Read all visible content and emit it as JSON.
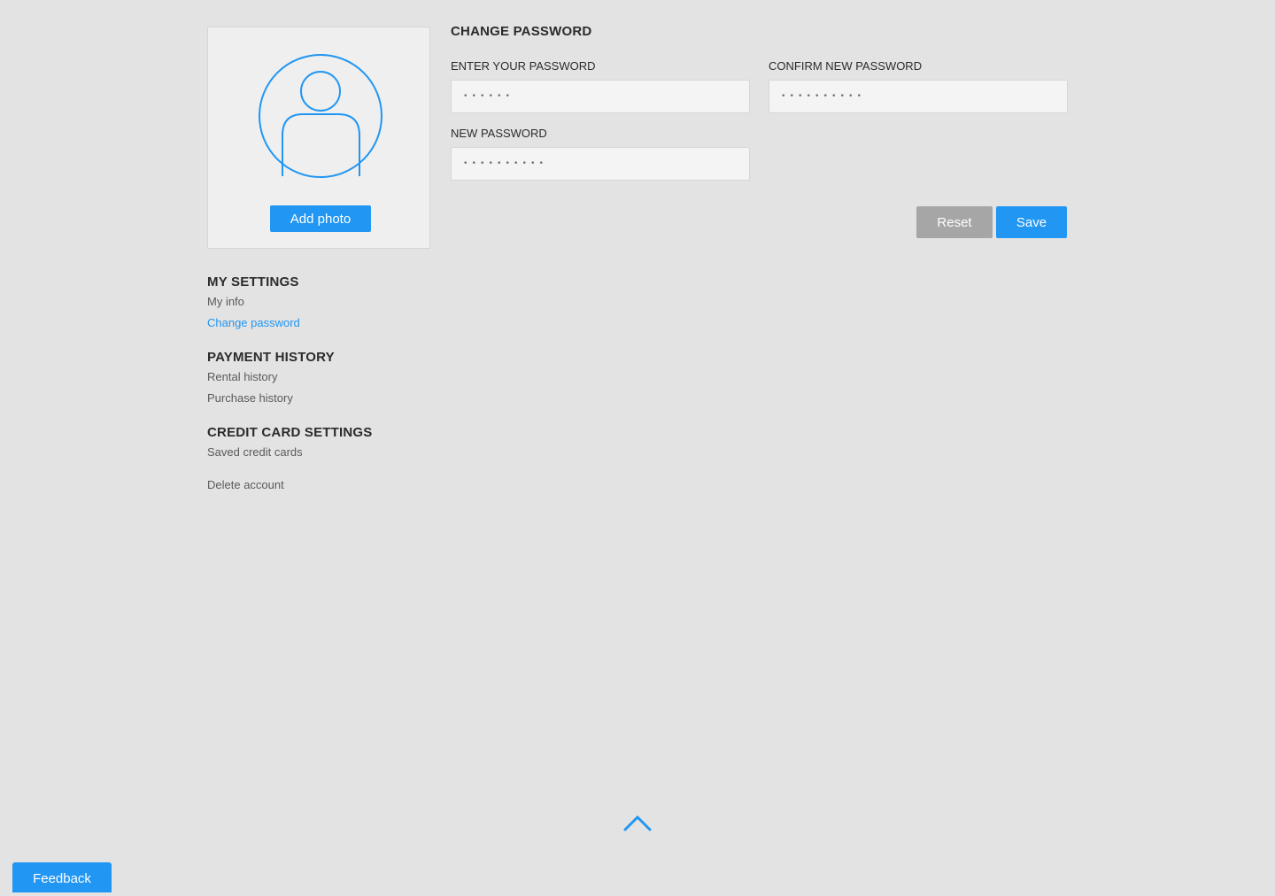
{
  "profile": {
    "add_photo_label": "Add photo"
  },
  "sidebar": {
    "my_settings": {
      "heading": "MY SETTINGS",
      "items": [
        "My info",
        "Change password"
      ],
      "active": "Change password"
    },
    "payment_history": {
      "heading": "PAYMENT HISTORY",
      "items": [
        "Rental history",
        "Purchase history"
      ]
    },
    "credit_card_settings": {
      "heading": "CREDIT CARD SETTINGS",
      "items": [
        "Saved credit cards"
      ]
    },
    "delete_account": "Delete account"
  },
  "change_password": {
    "title": "CHANGE PASSWORD",
    "current": {
      "label": "ENTER YOUR PASSWORD",
      "masked_value": "••••••"
    },
    "confirm": {
      "label": "CONFIRM NEW PASSWORD",
      "masked_value": "••••••••••"
    },
    "new": {
      "label": "NEW PASSWORD",
      "masked_value": "••••••••••"
    },
    "reset_label": "Reset",
    "save_label": "Save"
  },
  "feedback_label": "Feedback",
  "colors": {
    "accent": "#2196f3",
    "background": "#e3e3e3",
    "reset_button": "#a6a6a6"
  },
  "icons": {
    "avatar": "user-avatar-icon",
    "scroll_top": "chevron-up-icon"
  }
}
